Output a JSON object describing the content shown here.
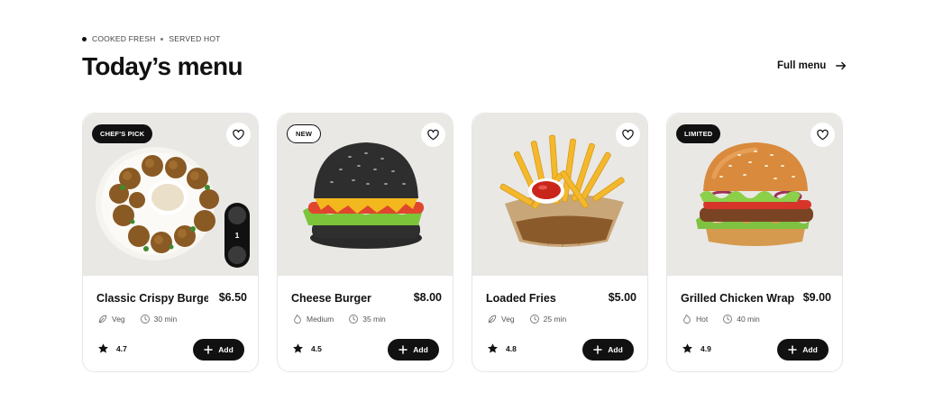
{
  "header": {
    "eyebrow_left": "COOKED FRESH",
    "eyebrow_right": "SERVED HOT",
    "title": "Today’s menu",
    "full_menu_label": "Full menu"
  },
  "cards": [
    {
      "badge": "CHEF'S PICK",
      "name": "Classic Crispy Burge",
      "price": "$6.50",
      "meta1": "Veg",
      "meta2": "30 min",
      "rating": "4.7",
      "add_label": "Add",
      "quantity": "1"
    },
    {
      "badge": "NEW",
      "name": "Cheese Burger",
      "price": "$8.00",
      "meta1": "Medium",
      "meta2": "35 min",
      "rating": "4.5",
      "add_label": "Add"
    },
    {
      "badge": "",
      "name": "Loaded Fries",
      "price": "$5.00",
      "meta1": "Veg",
      "meta2": "25 min",
      "rating": "4.8",
      "add_label": "Add"
    },
    {
      "badge": "LIMITED",
      "name": "Grilled Chicken Wrap",
      "price": "$9.00",
      "meta1": "Hot",
      "meta2": "40 min",
      "rating": "4.9",
      "add_label": "Add"
    }
  ]
}
